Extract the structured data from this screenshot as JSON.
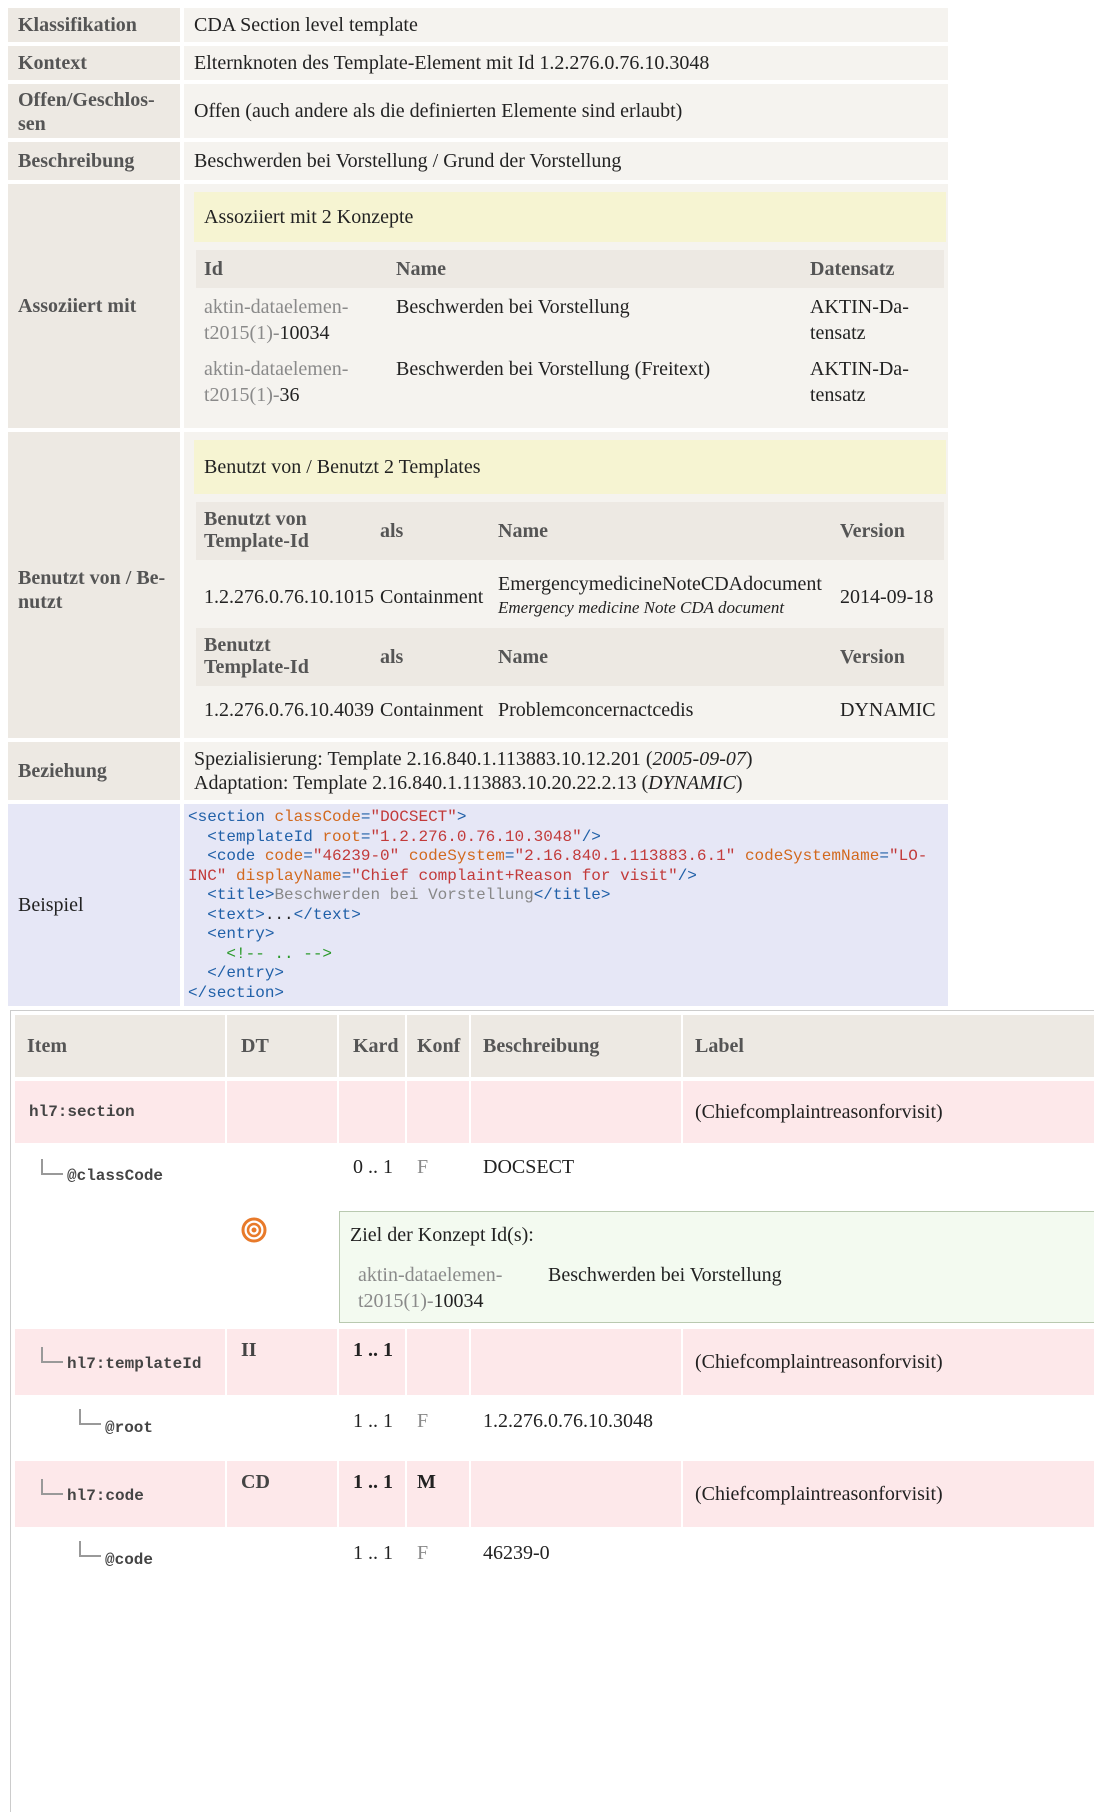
{
  "meta": {
    "rows": [
      {
        "label": "Klassifikation",
        "value": "CDA Section level template"
      },
      {
        "label": "Kontext",
        "value": "Elternknoten des Template-Element mit Id 1.2.276.0.76.10.3048"
      },
      {
        "label_l1": "Offen/Geschlos-",
        "label_l2": "sen",
        "value": "Offen (auch andere als die definierten Elemente sind erlaubt)"
      },
      {
        "label": "Beschreibung",
        "value": "Beschwerden bei Vorstellung / Grund der Vorstellung"
      }
    ]
  },
  "assoc": {
    "label": "Assoziiert mit",
    "heading": "Assoziiert mit 2 Konzepte",
    "columns": [
      "Id",
      "Name",
      "Datensatz"
    ],
    "rows": [
      {
        "id_l1": "aktin-dataelemen-",
        "id_l2a": "t2015(1)-",
        "id_l2b": "10034",
        "name": "Beschwerden bei Vorstellung",
        "ds_l1": "AKTIN-Da-",
        "ds_l2": "tensatz"
      },
      {
        "id_l1": "aktin-dataelemen-",
        "id_l2a": "t2015(1)-",
        "id_l2b": "36",
        "name": "Beschwerden bei Vorstellung (Freitext)",
        "ds_l1": "AKTIN-Da-",
        "ds_l2": "tensatz"
      }
    ]
  },
  "used": {
    "label_l1": "Benutzt von / Be-",
    "label_l2": "nutzt",
    "heading": "Benutzt von / Benutzt 2 Templates",
    "head1": {
      "c1_l1": "Benutzt von",
      "c1_l2": "Template-Id",
      "c2": "als",
      "c3": "Name",
      "c4": "Version"
    },
    "row1": {
      "id": "1.2.276.0.76.10.1015",
      "als": "Containment",
      "name": "EmergencymedicineNoteCDAdocument",
      "name_sub": "Emergency medicine Note CDA document",
      "version": "2014-09-18"
    },
    "head2": {
      "c1_l1": "Benutzt",
      "c1_l2": "Template-Id",
      "c2": "als",
      "c3": "Name",
      "c4": "Version"
    },
    "row2": {
      "id": "1.2.276.0.76.10.4039",
      "als": "Containment",
      "name": "Problemconcernactcedis",
      "version": "DYNAMIC"
    }
  },
  "relation": {
    "label": "Beziehung",
    "l1_text": "Spezialisierung: Template 2.16.840.1.113883.10.12.201 (",
    "l1_date": "2005-09-07",
    "l1_end": ")",
    "l2_text": "Adaptation: Template 2.16.840.1.113883.10.20.22.2.13 (",
    "l2_date": "DYNAMIC",
    "l2_end": ")"
  },
  "example": {
    "label": "Beispiel",
    "lines": {
      "section_open": "section",
      "classCode_attr": "classCode",
      "classCode_val": "\"DOCSECT\"",
      "templateId_tag": "templateId",
      "root_attr": "root",
      "root_val": "\"1.2.276.0.76.10.3048\"",
      "code_tag": "code",
      "code_attr": "code",
      "code_val": "\"46239-0\"",
      "cs_attr": "codeSystem",
      "cs_val": "\"2.16.840.1.113883.6.1\"",
      "csn_attr": "codeSystemName",
      "csn_val_a": "\"LO-",
      "csn_val_b": "INC\"",
      "dn_attr": "displayName",
      "dn_val": "\"Chief complaint+Reason for visit\"",
      "title_tag": "title",
      "title_text": "Beschwerden bei Vorstellung",
      "text_tag": "text",
      "text_dots": "...",
      "entry_tag": "entry",
      "comment": "<!-- .. -->",
      "section_close": "section"
    }
  },
  "table": {
    "columns": [
      "Item",
      "DT",
      "Kard",
      "Konf",
      "Beschreibung",
      "Label"
    ],
    "rows": [
      {
        "item": "hl7:section",
        "dt": "",
        "kard": "",
        "konf": "",
        "desc": "",
        "label": "(Chiefcomplaintreasonforvisit)"
      },
      {
        "item": "@classCode",
        "dt": "",
        "kard": "0 .. 1",
        "konf": "F",
        "desc": "DOCSECT",
        "label": ""
      },
      {
        "item": "hl7:templateId",
        "dt": "II",
        "kard": "1 .. 1",
        "konf": "",
        "desc": "",
        "label": "(Chiefcomplaintreasonforvisit)"
      },
      {
        "item": "@root",
        "dt": "",
        "kard": "1 .. 1",
        "konf": "F",
        "desc": "1.2.276.0.76.10.3048",
        "label": ""
      },
      {
        "item": "hl7:code",
        "dt": "CD",
        "kard": "1 .. 1",
        "konf": "M",
        "desc": "",
        "label": "(Chiefcomplaintreasonforvisit)"
      },
      {
        "item": "@code",
        "dt": "",
        "kard": "1 .. 1",
        "konf": "F",
        "desc": "46239-0",
        "label": ""
      }
    ],
    "concept_box": {
      "title": "Ziel der Konzept Id(s):",
      "id_l1": "aktin-dataelemen-",
      "id_l2a": "t2015(1)-",
      "id_l2b": "10034",
      "name": "Beschwerden bei Vorstellung"
    },
    "colors": {
      "pink": "#fde8ea",
      "header": "#ede9e3",
      "concept_bg": "#f3faf0",
      "target_icon": "#e87a2a"
    }
  }
}
